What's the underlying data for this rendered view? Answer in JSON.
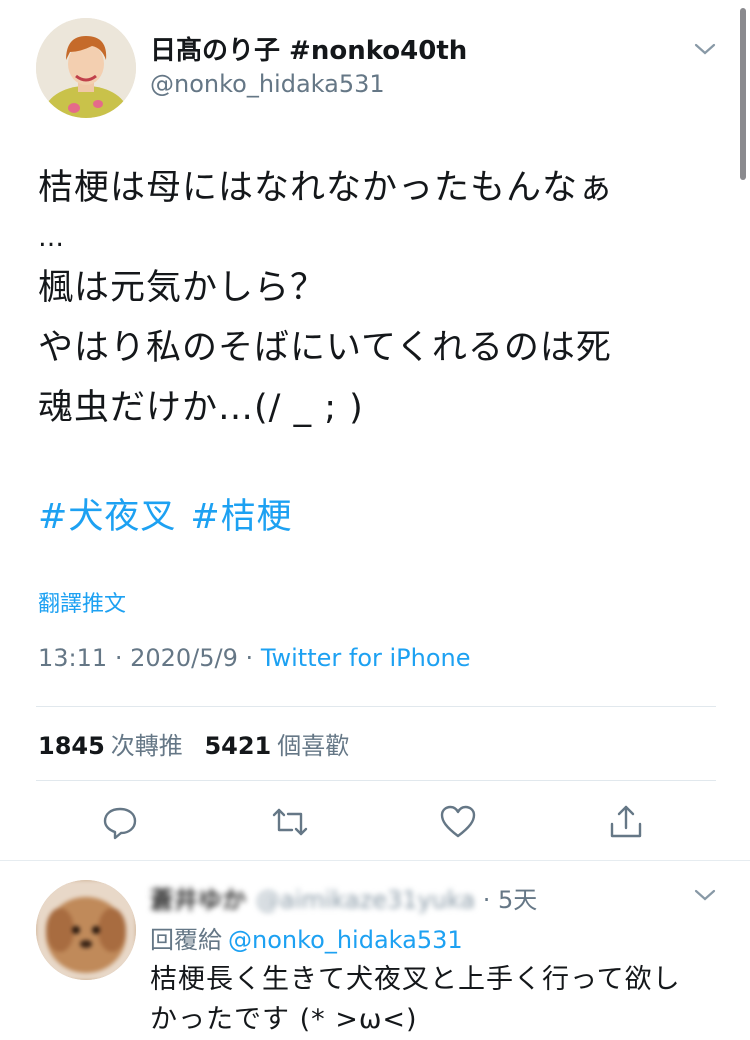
{
  "tweet": {
    "author_name": "日髙のり子 #nonko40th",
    "author_handle": "@nonko_hidaka531",
    "lines": [
      "桔梗は母にはなれなかったもんなぁ",
      "…",
      "楓は元気かしら？",
      "やはり私のそばにいてくれるのは死",
      "魂虫だけか…(/ _ ; )"
    ],
    "hashtags": [
      "#犬夜叉",
      "#桔梗"
    ],
    "translate_label": "翻譯推文",
    "time": "13:11",
    "date": "2020/5/9",
    "separator": "·",
    "source": "Twitter for iPhone",
    "retweet_count": "1845",
    "retweet_label": "次轉推",
    "like_count": "5421",
    "like_label": "個喜歡"
  },
  "actions": {
    "icons": [
      "reply-icon",
      "retweet-icon",
      "like-icon",
      "share-icon"
    ]
  },
  "reply": {
    "author_name": "蒼井ゆか",
    "author_handle": "@aimikaze31yuka",
    "separator": "·",
    "time": "5天",
    "replying_label": "回覆給",
    "replying_to": "@nonko_hidaka531",
    "text_line1": "桔梗長く生きて犬夜叉と上手く行って欲し",
    "text_line2": "かったです (* >ω<)"
  },
  "colors": {
    "accent": "#1da1f2",
    "secondary_text": "#657786",
    "primary_text": "#14171a",
    "divider": "#e1e8ed"
  }
}
